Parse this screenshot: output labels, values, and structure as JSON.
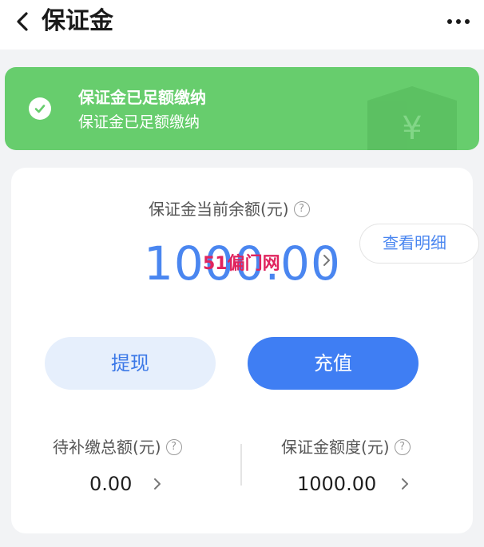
{
  "header": {
    "title": "保证金",
    "back_icon": "chevron-left-icon",
    "more_icon": "more-dots-icon"
  },
  "banner": {
    "title": "保证金已足额缴纳",
    "subtitle": "保证金已足额缴纳",
    "icon": "check-circle-icon",
    "color": "#67cd6d"
  },
  "balance": {
    "label": "保证金当前余额(元)",
    "help_icon": "question-circle-icon",
    "amount": "1000.00",
    "detail_button": "查看明细",
    "watermark": "51偏门网",
    "accent_color": "#4a86f0"
  },
  "actions": {
    "withdraw_label": "提现",
    "recharge_label": "充值"
  },
  "stats": {
    "pending": {
      "label": "待补缴总额(元)",
      "value": "0.00"
    },
    "quota": {
      "label": "保证金额度(元)",
      "value": "1000.00"
    }
  }
}
